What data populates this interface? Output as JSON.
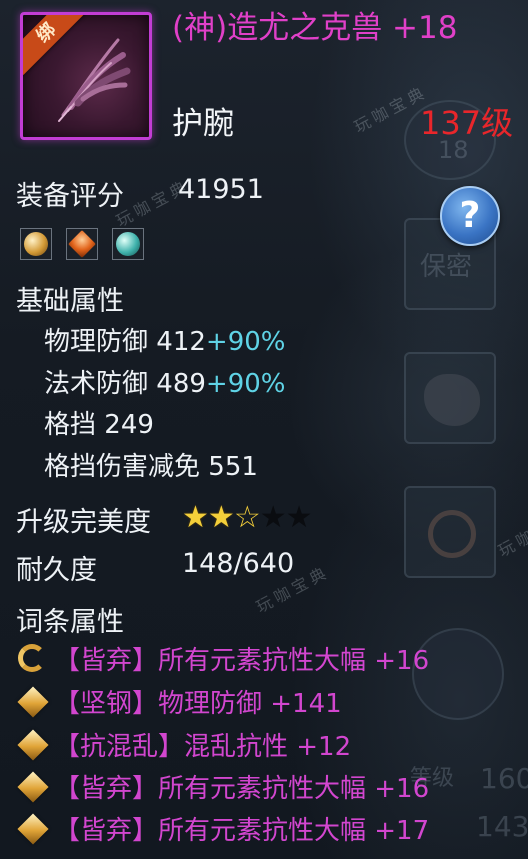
{
  "item": {
    "bind_label": "绑",
    "name": "(神)造尤之克兽 +18",
    "type": "护腕",
    "level": "137级"
  },
  "score": {
    "label": "装备评分",
    "value": "41951"
  },
  "help": {
    "icon": "question-icon",
    "symbol": "?"
  },
  "gems": [
    "gold-orb-gem-icon",
    "orange-crystal-gem-icon",
    "teal-orb-gem-icon"
  ],
  "base_attrs": {
    "title": "基础属性",
    "stats": [
      {
        "name": "物理防御",
        "value": "412",
        "bonus": "+90%"
      },
      {
        "name": "法术防御",
        "value": "489",
        "bonus": "+90%"
      },
      {
        "name": "格挡",
        "value": "249",
        "bonus": ""
      },
      {
        "name": "格挡伤害减免",
        "value": "551",
        "bonus": ""
      }
    ]
  },
  "upgrade": {
    "label": "升级完美度",
    "stars_total": 5,
    "stars_filled": 2,
    "stars_outline": 1
  },
  "durability": {
    "label": "耐久度",
    "value": "148/640"
  },
  "affixes": {
    "title": "词条属性",
    "items": [
      {
        "icon": "swirl-icon",
        "text": "【皆弃】所有元素抗性大幅 +16"
      },
      {
        "icon": "diamond-icon",
        "text": "【坚钢】物理防御 +141"
      },
      {
        "icon": "diamond-icon",
        "text": "【抗混乱】混乱抗性 +12"
      },
      {
        "icon": "diamond-icon",
        "text": "【皆弃】所有元素抗性大幅 +16"
      },
      {
        "icon": "diamond-icon",
        "text": "【皆弃】所有元素抗性大幅 +17"
      }
    ]
  },
  "background": {
    "faded_labels": [
      "18",
      "保密",
      "等级",
      "160",
      "143"
    ],
    "watermark": "玩咖宝典"
  },
  "colors": {
    "item_name": "#e040c8",
    "level": "#e8262b",
    "bonus": "#5fd3e6",
    "affix": "#d246cf",
    "star": "#f4cf3a"
  }
}
